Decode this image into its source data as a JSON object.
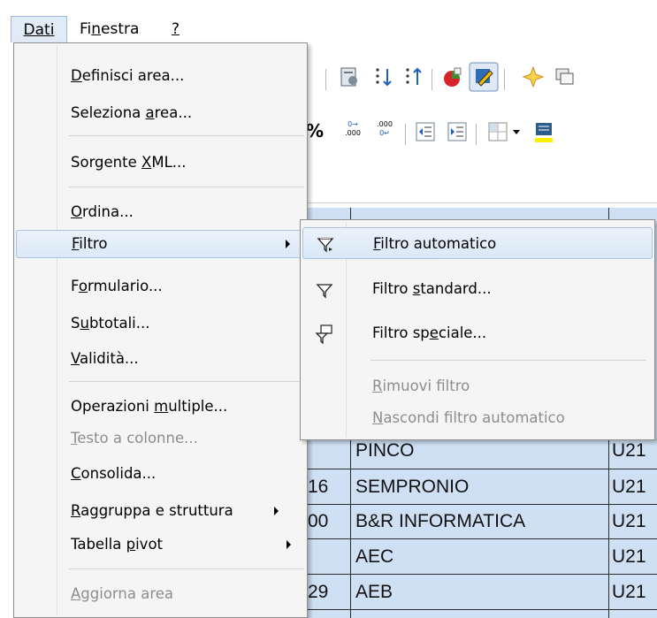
{
  "menubar": {
    "dati": "Dati",
    "finestra_pre": "Fi",
    "finestra_u": "n",
    "finestra_post": "estra",
    "help": "?"
  },
  "menu_dati": {
    "definisci_u": "D",
    "definisci_rest": "efinisci area...",
    "seleziona_pre": "Seleziona ",
    "seleziona_u": "a",
    "seleziona_post": "rea...",
    "sorgente_pre": "Sorgente ",
    "sorgente_u": "X",
    "sorgente_post": "ML...",
    "ordina_u": "O",
    "ordina_rest": "rdina...",
    "filtro_u": "F",
    "filtro_rest": "iltro",
    "formulario_pre": "F",
    "formulario_u": "o",
    "formulario_post": "rmulario...",
    "subtotali_pre": "S",
    "subtotali_u": "u",
    "subtotali_post": "btotali...",
    "validita_u": "V",
    "validita_rest": "alidità...",
    "operazioni_pre": "Operazioni ",
    "operazioni_u": "m",
    "operazioni_post": "ultiple...",
    "testo_u": "T",
    "testo_rest": "esto a colonne...",
    "consolida_u": "C",
    "consolida_rest": "onsolida...",
    "raggruppa_u": "R",
    "raggruppa_rest": "aggruppa e struttura",
    "tabella_pre": "Tabella ",
    "tabella_u": "p",
    "tabella_post": "ivot",
    "aggiorna_u": "A",
    "aggiorna_rest": "ggiorna area"
  },
  "submenu_filtro": {
    "auto_u": "F",
    "auto_rest": "iltro automatico",
    "standard_pre": "Filtro ",
    "standard_u": "s",
    "standard_post": "tandard...",
    "speciale_pre": "Filtro sp",
    "speciale_u": "e",
    "speciale_post": "ciale...",
    "rimuovi_u": "R",
    "rimuovi_rest": "imuovi filtro",
    "nascondi_u": "N",
    "nascondi_rest": "ascondi filtro automatico"
  },
  "toolbar_text": {
    "percent": "%",
    "dec_add": ".000",
    "dec_rm": ".000"
  },
  "sheet": {
    "rows": [
      {
        "num": "",
        "name": "PINCO",
        "code": "U21"
      },
      {
        "num": "16",
        "name": "SEMPRONIO",
        "code": "U21"
      },
      {
        "num": "00",
        "name": "B&R INFORMATICA",
        "code": "U21"
      },
      {
        "num": "",
        "name": "AEC",
        "code": "U21"
      },
      {
        "num": "29",
        "name": "AEB",
        "code": "U21"
      }
    ]
  },
  "colors": {
    "highlight": "#dbe8f7",
    "cell_bg": "#cfe0f4",
    "disabled_text": "#8d8d8d"
  }
}
